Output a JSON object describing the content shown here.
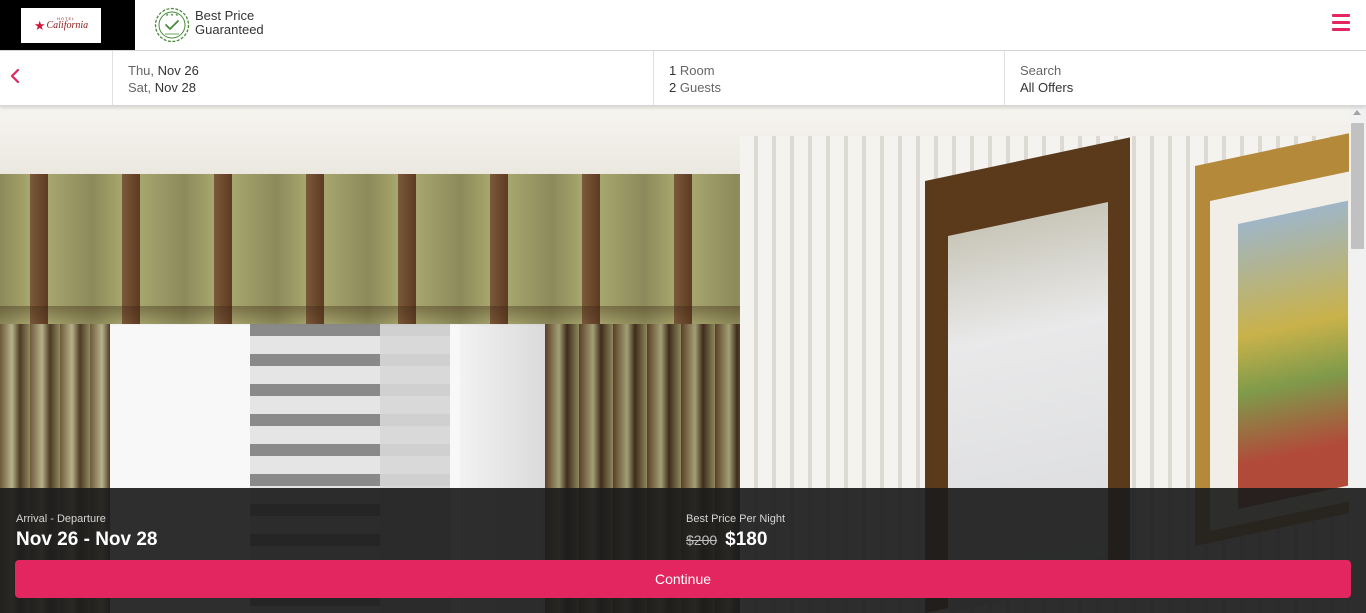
{
  "header": {
    "logo_text": "California",
    "logo_subtext": "HOTEL",
    "best_price_line1": "Best Price",
    "best_price_line2": "Guaranteed",
    "menu_icon": "hamburger-menu-icon",
    "accent_color": "#e3265f"
  },
  "search": {
    "back_icon": "chevron-left-icon",
    "dates": {
      "checkin_weekday": "Thu,",
      "checkin_date": "Nov 26",
      "checkout_weekday": "Sat,",
      "checkout_date": "Nov 28"
    },
    "guests": {
      "rooms_count": "1",
      "rooms_label": "Room",
      "guests_count": "2",
      "guests_label": "Guests"
    },
    "offers": {
      "label": "Search",
      "value": "All Offers"
    }
  },
  "booking": {
    "arrival_label": "Arrival - Departure",
    "arrival_value": "Nov 26 - Nov 28",
    "price_label": "Best Price Per Night",
    "old_price": "$200",
    "new_price": "$180",
    "continue_label": "Continue"
  }
}
